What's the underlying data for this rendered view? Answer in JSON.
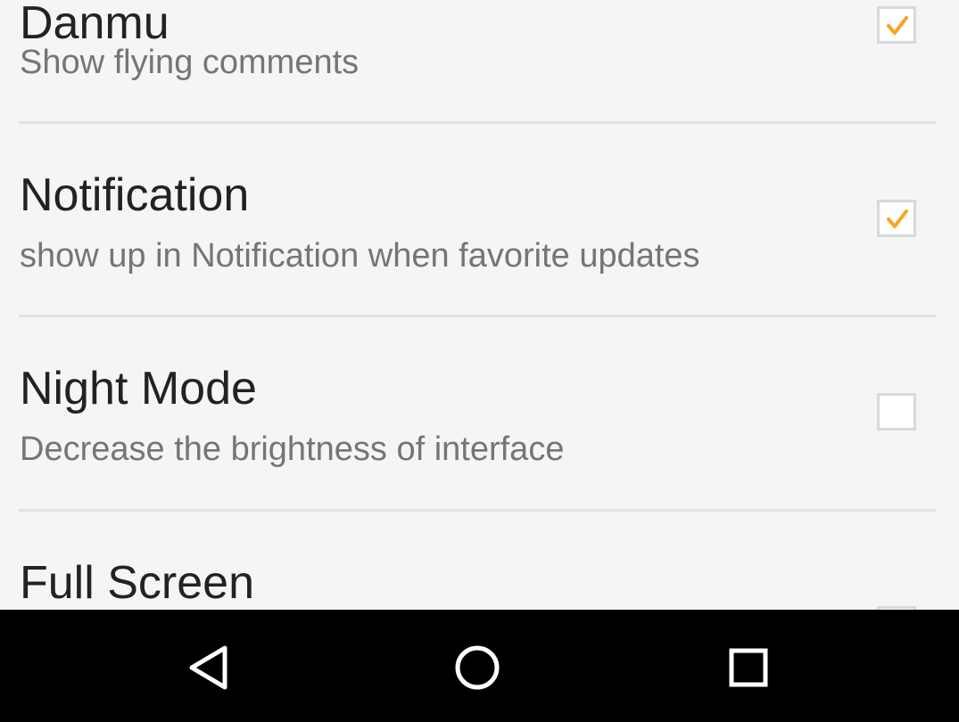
{
  "settings": {
    "items": [
      {
        "title": "Danmu",
        "summary": "Show flying comments",
        "checked": true
      },
      {
        "title": "Notification",
        "summary": "show up in Notification when favorite updates",
        "checked": true
      },
      {
        "title": "Night Mode",
        "summary": "Decrease the brightness of interface",
        "checked": false
      },
      {
        "title": "Full Screen",
        "summary": "",
        "checked": false
      }
    ]
  },
  "colors": {
    "checkmark": "#f5a623",
    "background": "#f5f5f5",
    "title_text": "#222222",
    "summary_text": "#757575",
    "nav_bar": "#000000"
  },
  "nav_bar": {
    "icons": [
      "back-icon",
      "home-icon",
      "recents-icon"
    ]
  }
}
